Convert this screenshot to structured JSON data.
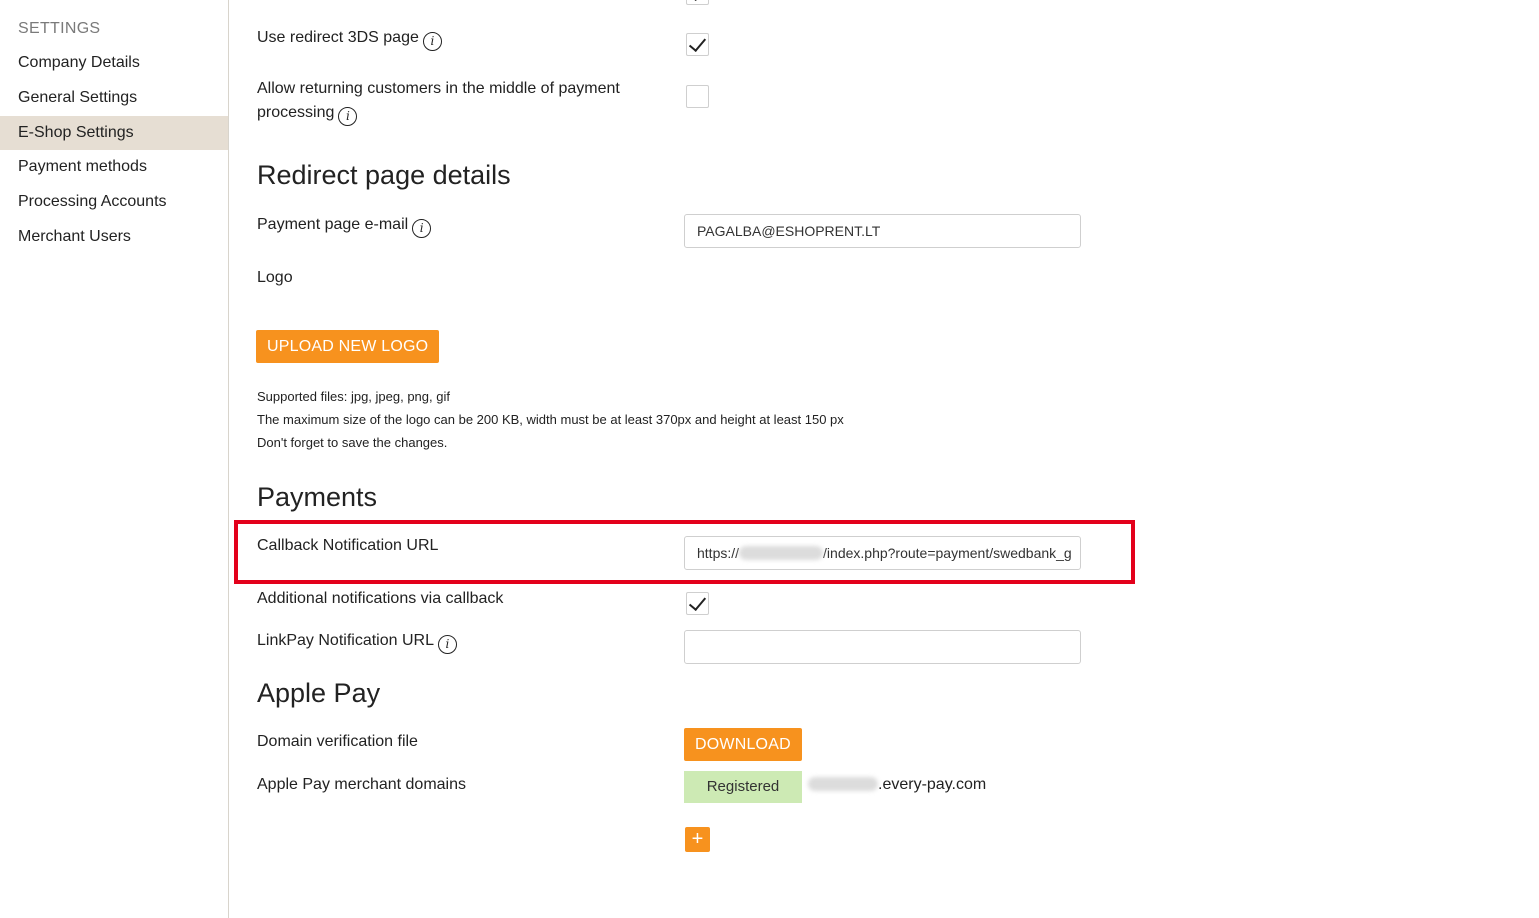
{
  "sidebar": {
    "title": "SETTINGS",
    "items": [
      {
        "label": "Company Details"
      },
      {
        "label": "General Settings"
      },
      {
        "label": "E-Shop Settings"
      },
      {
        "label": "Payment methods"
      },
      {
        "label": "Processing Accounts"
      },
      {
        "label": "Merchant Users"
      }
    ]
  },
  "eshop": {
    "redirect_3ds_label": "Use redirect 3DS page",
    "returning_customers_label_line1": "Allow returning customers in the middle of payment",
    "returning_customers_label_line2": "processing"
  },
  "redirect_page": {
    "heading": "Redirect page details",
    "email_label": "Payment page e-mail",
    "email_value": "PAGALBA@ESHOPRENT.LT",
    "logo_label": "Logo",
    "upload_button": "UPLOAD NEW LOGO",
    "note_1": "Supported files: jpg, jpeg, png, gif",
    "note_2": "The maximum size of the logo can be 200 KB, width must be at least 370px and height at least 150 px",
    "note_3": "Don't forget to save the changes."
  },
  "payments": {
    "heading": "Payments",
    "callback_label": "Callback Notification URL",
    "callback_prefix": "https://",
    "callback_suffix": "/index.php?route=payment/swedbank_g",
    "additional_label": "Additional notifications via callback",
    "linkpay_label": "LinkPay Notification URL",
    "linkpay_value": ""
  },
  "apple_pay": {
    "heading": "Apple Pay",
    "domain_file_label": "Domain verification file",
    "download_button": "DOWNLOAD",
    "merchant_domains_label": "Apple Pay merchant domains",
    "status_badge": "Registered",
    "domain_suffix": ".every-pay.com",
    "add_button": "+"
  },
  "colors": {
    "accent": "#f7921e",
    "highlight": "#e3001b",
    "registered": "#cdeab4",
    "sidebar_active": "#e6ded3"
  },
  "icons": {
    "info": "info-icon",
    "check": "checkmark-icon",
    "plus": "plus-icon"
  }
}
